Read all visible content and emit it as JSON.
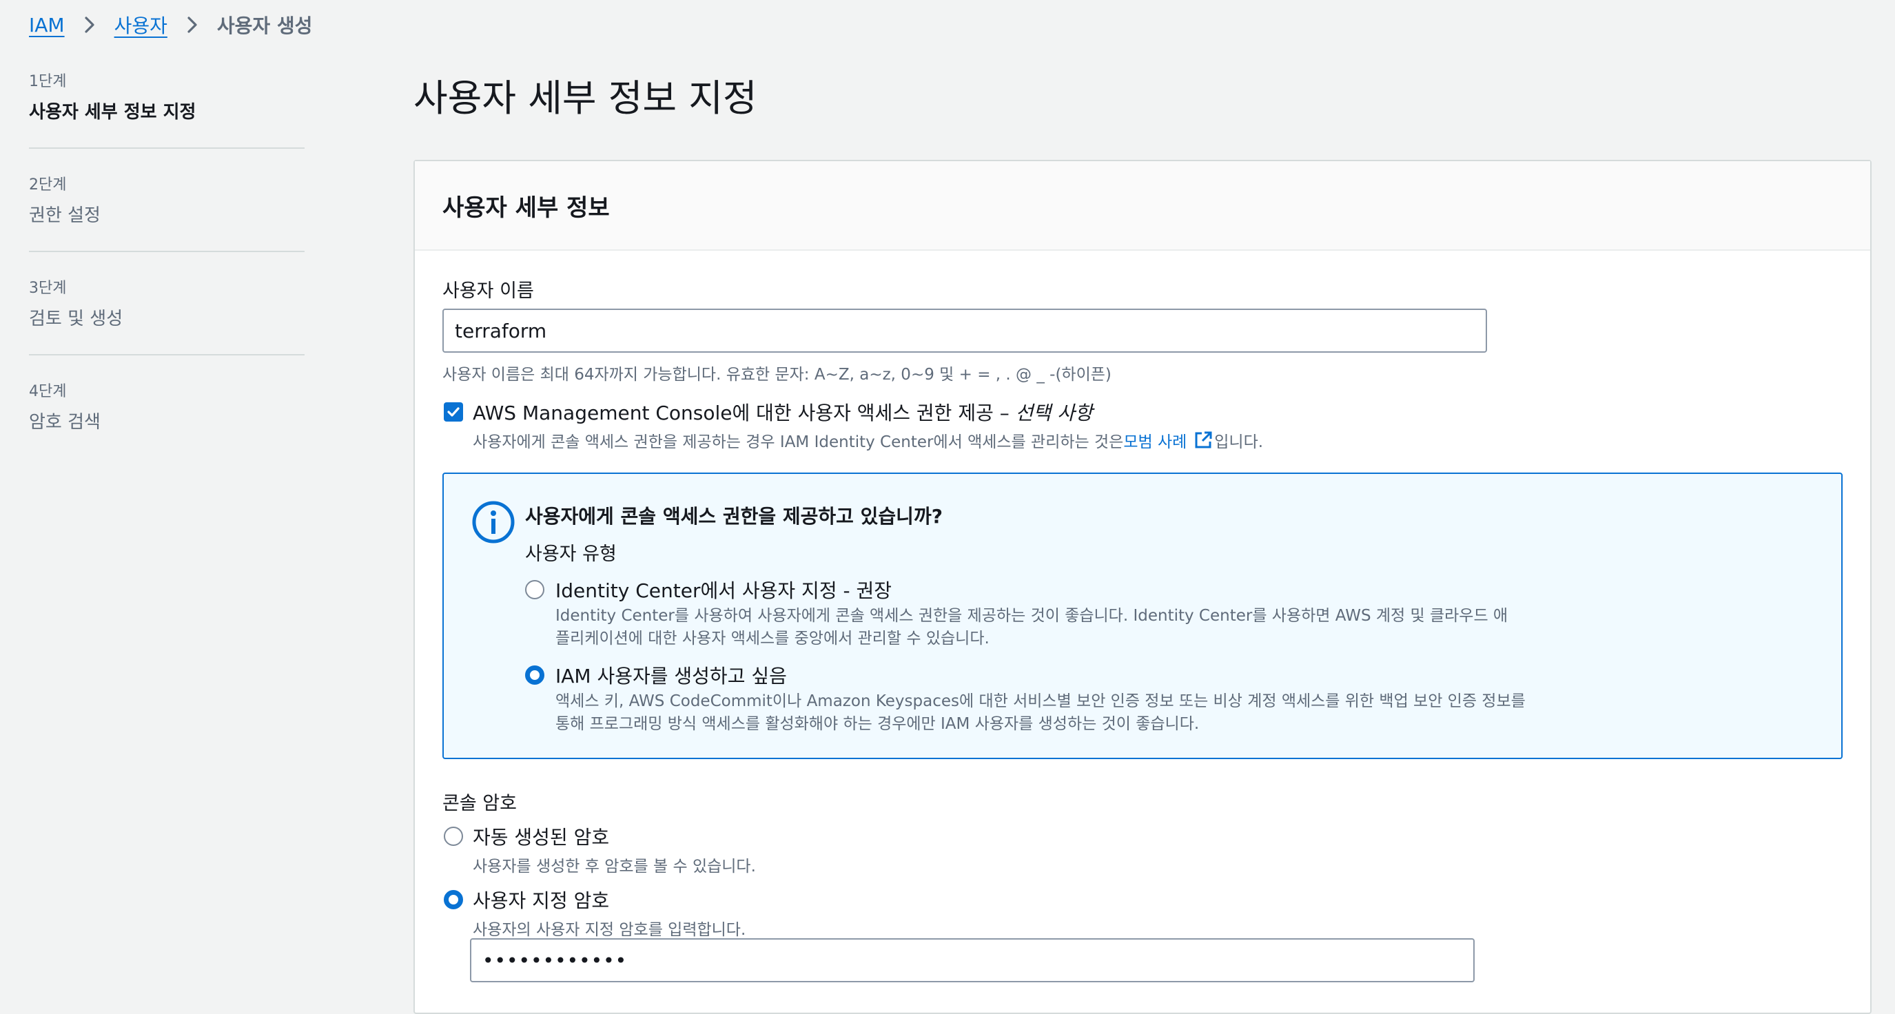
{
  "breadcrumb": {
    "items": [
      {
        "label": "IAM"
      },
      {
        "label": "사용자"
      }
    ],
    "current": "사용자 생성"
  },
  "steps": [
    {
      "number": "1단계",
      "label": "사용자 세부 정보 지정",
      "active": true
    },
    {
      "number": "2단계",
      "label": "권한 설정",
      "active": false
    },
    {
      "number": "3단계",
      "label": "검토 및 생성",
      "active": false
    },
    {
      "number": "4단계",
      "label": "암호 검색",
      "active": false
    }
  ],
  "page": {
    "title": "사용자 세부 정보 지정"
  },
  "panel": {
    "title": "사용자 세부 정보",
    "username": {
      "label": "사용자 이름",
      "value": "terraform",
      "hint": "사용자 이름은 최대 64자까지 가능합니다. 유효한 문자: A~Z, a~z, 0~9 및 + = , . @ _ -(하이픈)"
    },
    "console_access": {
      "checked": true,
      "label": "AWS Management Console에 대한 사용자 액세스 권한 제공 – ",
      "optional": "선택 사항",
      "desc_prefix": "사용자에게 콘솔 액세스 권한을 제공하는 경우 IAM Identity Center에서 액세스를 관리하는 것은 ",
      "desc_link": "모범 사례",
      "desc_suffix": "입니다."
    },
    "info": {
      "heading": "사용자에게 콘솔 액세스 권한을 제공하고 있습니까?",
      "user_type_label": "사용자 유형",
      "options": [
        {
          "label": "Identity Center에서 사용자 지정 - 권장",
          "desc1": "Identity Center를 사용하여 사용자에게 콘솔 액세스 권한을 제공하는 것이 좋습니다. Identity Center를 사용하면 AWS 계정 및 클라우드 애",
          "desc2": "플리케이션에 대한 사용자 액세스를 중앙에서 관리할 수 있습니다.",
          "checked": false
        },
        {
          "label": "IAM 사용자를 생성하고 싶음",
          "desc1": "액세스 키, AWS CodeCommit이나 Amazon Keyspaces에 대한 서비스별 보안 인증 정보 또는 비상 계정 액세스를 위한 백업 보안 인증 정보를",
          "desc2": "통해 프로그래밍 방식 액세스를 활성화해야 하는 경우에만 IAM 사용자를 생성하는 것이 좋습니다.",
          "checked": true
        }
      ]
    },
    "password": {
      "label": "콘솔 암호",
      "options": [
        {
          "label": "자동 생성된 암호",
          "desc": "사용자를 생성한 후 암호를 볼 수 있습니다.",
          "checked": false
        },
        {
          "label": "사용자 지정 암호",
          "desc": "사용자의 사용자 지정 암호를 입력합니다.",
          "checked": true
        }
      ],
      "value": "••••••••••••"
    }
  },
  "colors": {
    "accent": "#0972d3",
    "background": "#f2f3f3",
    "info_bg": "#f1faff"
  }
}
